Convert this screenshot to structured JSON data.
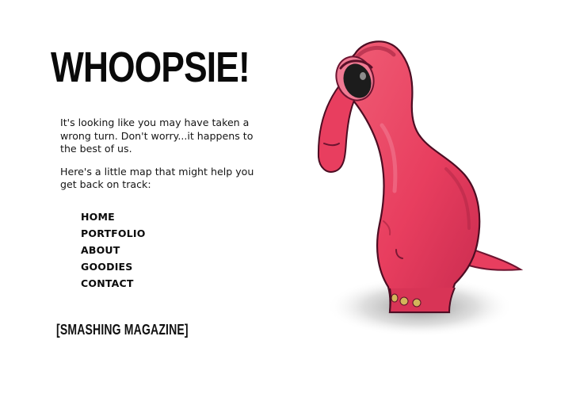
{
  "header": {
    "title": "WHOOPSIE!"
  },
  "message": {
    "paragraph_1": "It's looking like you may have taken a wrong turn. Don't worry...it happens to the best of us.",
    "paragraph_2": "Here's a little map that might help you get back on track:"
  },
  "navigation": {
    "items": [
      {
        "label": "HOME"
      },
      {
        "label": "PORTFOLIO"
      },
      {
        "label": "ABOUT"
      },
      {
        "label": "GOODIES"
      },
      {
        "label": "CONTACT"
      }
    ]
  },
  "footer": {
    "brand_link": "[SMASHING MAGAZINE]"
  },
  "illustration": {
    "name": "pink-dinosaur-illustration",
    "body_color": "#e83e5f",
    "shadow_color": "#9b1f3d",
    "eye_color": "#1c1c1c",
    "toe_color": "#d3b55a"
  }
}
